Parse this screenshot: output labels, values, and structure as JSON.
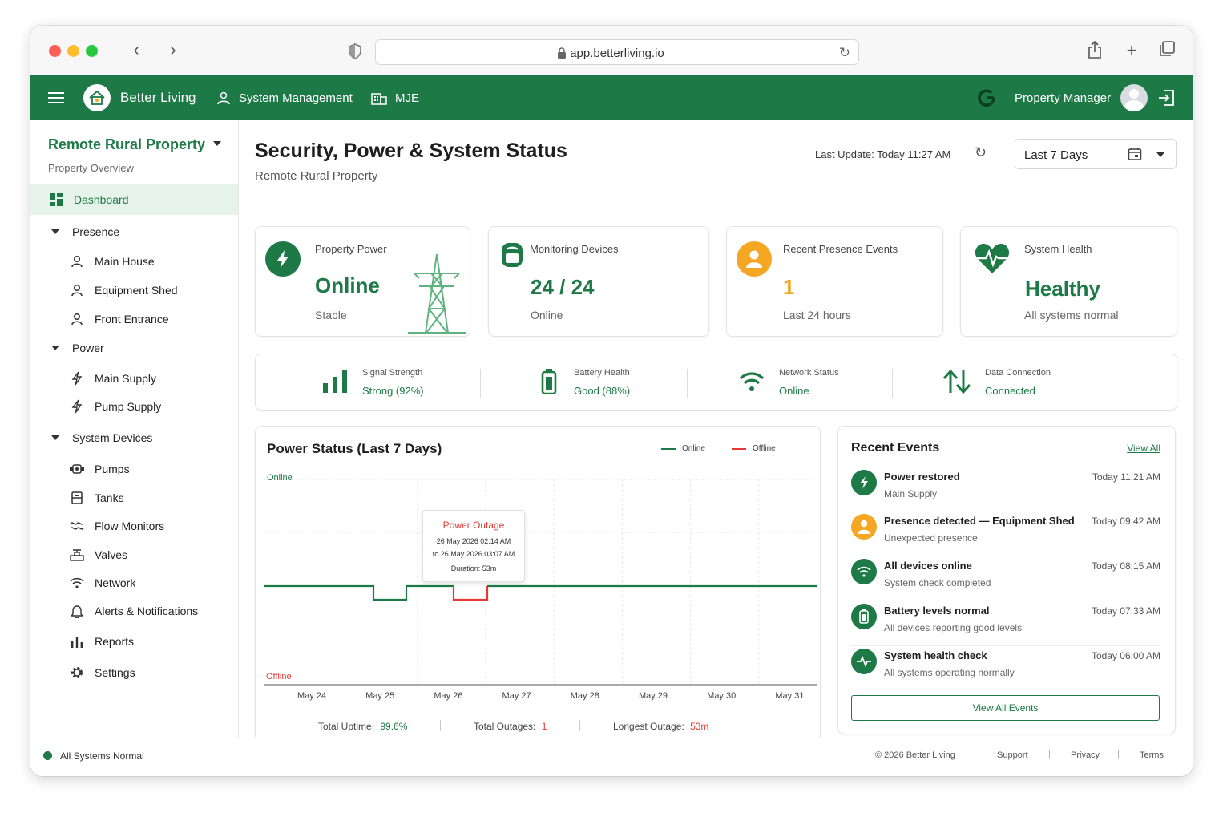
{
  "browser": {
    "url": "app.betterliving.io"
  },
  "header": {
    "brand": "Better Living",
    "nav_system": "System Management",
    "nav_site": "MJE",
    "user": "Property Manager"
  },
  "sidebar": {
    "property": "Remote Rural Property",
    "property_sub": "Property Overview",
    "dashboard": "Dashboard",
    "presence": {
      "label": "Presence",
      "items": [
        "Main House",
        "Equipment Shed",
        "Front Entrance"
      ]
    },
    "power": {
      "label": "Power",
      "items": [
        "Main Supply",
        "Pump Supply"
      ]
    },
    "devices": {
      "label": "System Devices",
      "items": [
        "Pumps",
        "Tanks",
        "Flow Monitors",
        "Valves",
        "Network",
        "Alerts & Notifications",
        "Reports",
        "Settings"
      ]
    }
  },
  "main": {
    "title": "Security, Power & System Status",
    "subtitle": "Remote Rural Property",
    "last_update": "Last Update: Today 11:27 AM",
    "range": "Last 7 Days"
  },
  "kpis": {
    "power": {
      "label": "Property Power",
      "value": "Online",
      "sub": "Stable"
    },
    "devices": {
      "label": "Monitoring Devices",
      "value": "24 / 24",
      "sub": "Online"
    },
    "presence": {
      "label": "Recent Presence Events",
      "value": "1",
      "sub": "Last 24 hours"
    },
    "health": {
      "label": "System Health",
      "value": "Healthy",
      "sub": "All systems normal"
    }
  },
  "stats": {
    "signal": {
      "label": "Signal Strength",
      "value": "Strong (92%)"
    },
    "battery": {
      "label": "Battery Health",
      "value": "Good (88%)"
    },
    "network": {
      "label": "Network Status",
      "value": "Online"
    },
    "data": {
      "label": "Data Connection",
      "value": "Connected"
    }
  },
  "chart": {
    "title": "Power Status (Last 7 Days)",
    "legend_online": "Online",
    "legend_offline": "Offline",
    "y_online": "Online",
    "y_offline": "Offline",
    "tooltip": {
      "title": "Power Outage",
      "from": "26 May 2026 02:14 AM",
      "to": "to 26 May 2026 03:07 AM",
      "duration": "Duration: 53m"
    },
    "summary": {
      "uptime_label": "Total Uptime:",
      "uptime": "99.6%",
      "outages_label": "Total Outages:",
      "outages": "1",
      "longest_label": "Longest Outage:",
      "longest": "53m"
    }
  },
  "chart_data": {
    "type": "line",
    "title": "Power Status (Last 7 Days)",
    "categories": [
      "May 24",
      "May 25",
      "May 26",
      "May 27",
      "May 28",
      "May 29",
      "May 30",
      "May 31"
    ],
    "y_levels": [
      "Offline",
      "Online"
    ],
    "series": [
      {
        "name": "Online",
        "color": "#1d7a46",
        "status": [
          1,
          0.93,
          1,
          1,
          1,
          1,
          1,
          1
        ]
      },
      {
        "name": "Offline",
        "color": "#e53935",
        "outage": {
          "start": "26 May 2026 02:14 AM",
          "end": "26 May 2026 03:07 AM",
          "duration": "53m"
        }
      }
    ]
  },
  "events": {
    "title": "Recent Events",
    "view_all": "View All",
    "button": "View All Events",
    "items": [
      {
        "title": "Power restored",
        "sub": "Main Supply",
        "time": "Today 11:21 AM"
      },
      {
        "title": "Presence detected — Equipment Shed",
        "sub": "Unexpected presence",
        "time": "Today 09:42 AM"
      },
      {
        "title": "All devices online",
        "sub": "System check completed",
        "time": "Today 08:15 AM"
      },
      {
        "title": "Battery levels normal",
        "sub": "All devices reporting good levels",
        "time": "Today 07:33 AM"
      },
      {
        "title": "System health check",
        "sub": "All systems operating normally",
        "time": "Today 06:00 AM"
      }
    ]
  },
  "footer": {
    "status": "All Systems Normal",
    "copyright": "© 2026 Better Living",
    "links": [
      "Support",
      "Privacy",
      "Terms"
    ]
  },
  "colors": {
    "brand": "#1d7a46",
    "warning": "#f5a623",
    "danger": "#e53935"
  }
}
